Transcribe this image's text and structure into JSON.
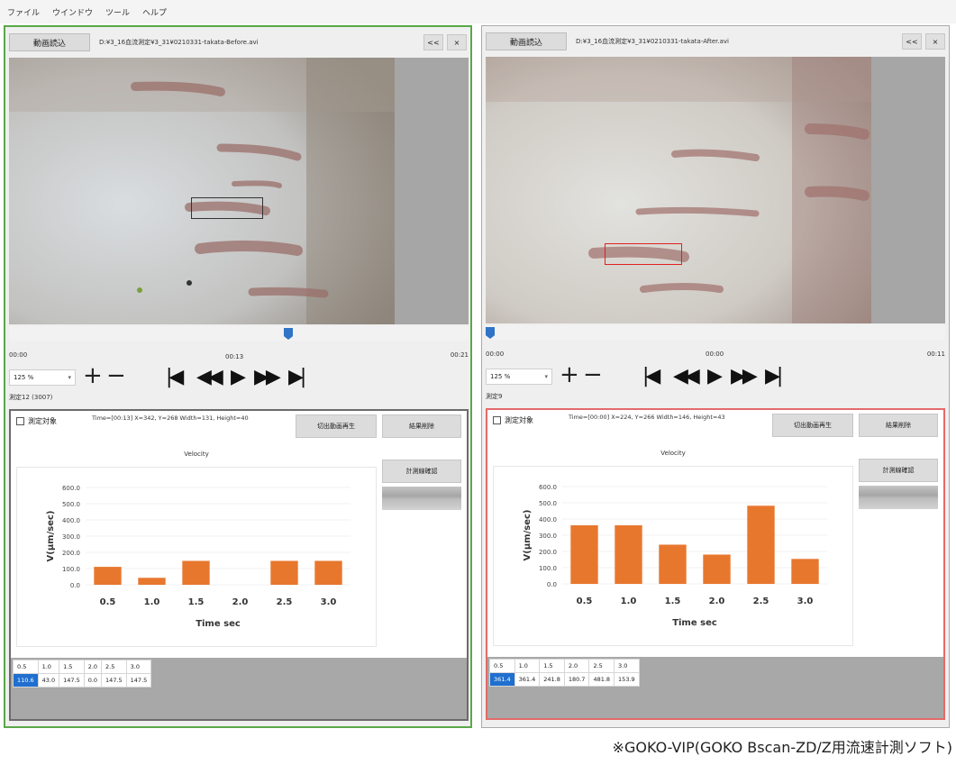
{
  "menu": [
    "ファイル",
    "ウインドウ",
    "ツール",
    "ヘルプ"
  ],
  "panels": [
    {
      "id": "left",
      "load_label": "動画読込",
      "file_path": "D:¥3_16血流測定¥3_31¥0210331-takata-Before.avi",
      "collapse_label": "<<",
      "close_label": "×",
      "seek_fraction": 0.61,
      "time_start": "00:00",
      "time_current": "00:13",
      "time_end": "00:21",
      "zoom_value": "125 %",
      "measure_label": "測定12 (3007)",
      "checkbox_label": "測定対象",
      "roi_info": "Time=[00:13] X=342, Y=268 Width=131, Height=40",
      "cut_label": "切出動画再生",
      "delete_label": "結果削除",
      "verify_label": "計測線確認",
      "chart_data": {
        "type": "bar",
        "title": "Velocity",
        "xlabel": "Time sec",
        "ylabel": "V(μm/sec)",
        "categories": [
          "0.5",
          "1.0",
          "1.5",
          "2.0",
          "2.5",
          "3.0"
        ],
        "values": [
          110.6,
          43.0,
          147.5,
          0.0,
          147.5,
          147.5
        ],
        "yticks": [
          "600.0",
          "500.0",
          "400.0",
          "300.0",
          "200.0",
          "100.0",
          "0.0"
        ],
        "ylim": [
          0,
          600
        ],
        "bar_color": "#e8772e"
      },
      "table": {
        "headers": [
          "0.5",
          "1.0",
          "1.5",
          "2.0",
          "2.5",
          "3.0"
        ],
        "values": [
          "110.6",
          "43.0",
          "147.5",
          "0.0",
          "147.5",
          "147.5"
        ]
      }
    },
    {
      "id": "right",
      "load_label": "動画読込",
      "file_path": "D:¥3_16血流測定¥3_31¥0210331-takata-After.avi",
      "collapse_label": "<<",
      "close_label": "×",
      "seek_fraction": 0.0,
      "time_start": "00:00",
      "time_current": "00:00",
      "time_end": "00:11",
      "zoom_value": "125 %",
      "measure_label": "測定9",
      "checkbox_label": "測定対象",
      "roi_info": "Time=[00:00] X=224, Y=266 Width=146, Height=43",
      "cut_label": "切出動画再生",
      "delete_label": "結果削除",
      "verify_label": "計測線確認",
      "chart_data": {
        "type": "bar",
        "title": "Velocity",
        "xlabel": "Time sec",
        "ylabel": "V(μm/sec)",
        "categories": [
          "0.5",
          "1.0",
          "1.5",
          "2.0",
          "2.5",
          "3.0"
        ],
        "values": [
          361.4,
          361.4,
          241.8,
          180.7,
          481.8,
          153.9
        ],
        "yticks": [
          "600.0",
          "500.0",
          "400.0",
          "300.0",
          "200.0",
          "100.0",
          "0.0"
        ],
        "ylim": [
          0,
          600
        ],
        "bar_color": "#e8772e"
      },
      "table": {
        "headers": [
          "0.5",
          "1.0",
          "1.5",
          "2.0",
          "2.5",
          "3.0"
        ],
        "values": [
          "361.4",
          "361.4",
          "241.8",
          "180.7",
          "481.8",
          "153.9"
        ]
      }
    }
  ],
  "caption": "※GOKO-VIP(GOKO Bscan-ZD/Z用流速計測ソフト)",
  "colors": {
    "left_border": "#5aa84a",
    "right_result_border": "#e36a6a",
    "seek_thumb": "#2f74c7",
    "selected_cell": "#1f6fd0"
  }
}
